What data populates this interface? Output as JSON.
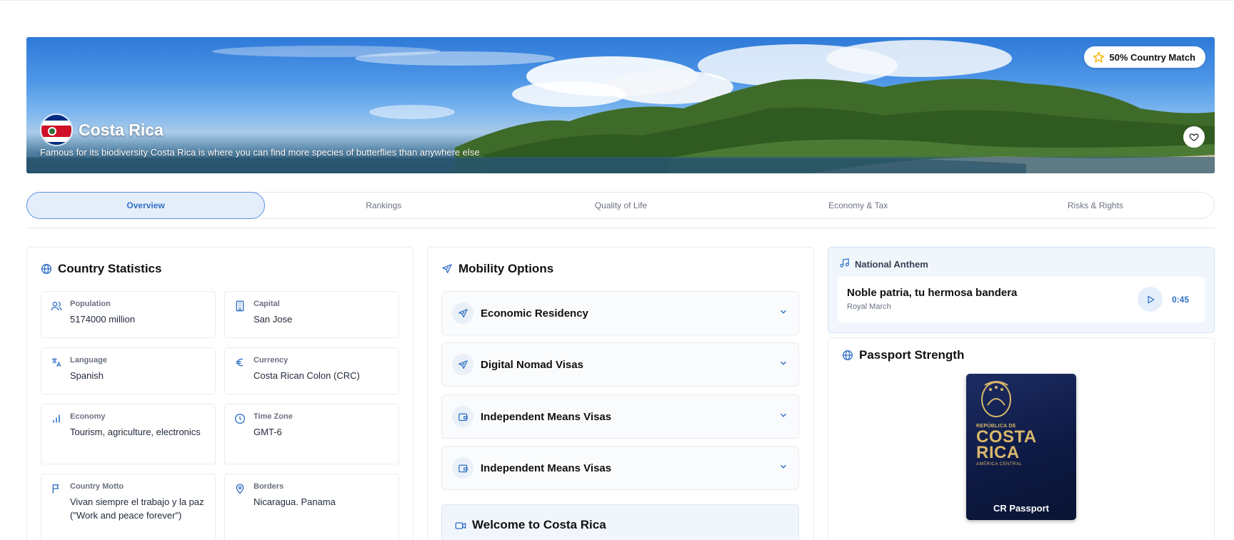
{
  "hero": {
    "country": "Costa Rica",
    "description": "Famous for its biodiversity Costa Rica is where you can find more species of butterflies than anywhere else",
    "match_badge": "50% Country Match",
    "flag_colors": [
      "#002b7f",
      "#ffffff",
      "#ce1126"
    ]
  },
  "tabs": [
    {
      "label": "Overview",
      "active": true
    },
    {
      "label": "Rankings"
    },
    {
      "label": "Quality of Life"
    },
    {
      "label": "Economy & Tax"
    },
    {
      "label": "Risks & Rights"
    }
  ],
  "stats": {
    "title": "Country Statistics",
    "items": [
      {
        "label": "Population",
        "value": "5174000 million",
        "icon": "users-icon"
      },
      {
        "label": "Capital",
        "value": "San Jose",
        "icon": "building-icon"
      },
      {
        "label": "Language",
        "value": "Spanish",
        "icon": "language-icon"
      },
      {
        "label": "Currency",
        "value": "Costa Rican Colon (CRC)",
        "icon": "euro-icon"
      },
      {
        "label": "Economy",
        "value": "Tourism, agriculture, electronics",
        "icon": "bar-chart-icon"
      },
      {
        "label": "Time Zone",
        "value": "GMT-6",
        "icon": "clock-icon"
      },
      {
        "label": "Country Motto",
        "value": "Vivan siempre el trabajo y la paz (\"Work and peace forever\")",
        "icon": "flag-icon"
      },
      {
        "label": "Borders",
        "value": "Nicaragua. Panama",
        "icon": "map-pin-icon"
      }
    ]
  },
  "mobility": {
    "title": "Mobility Options",
    "items": [
      {
        "label": "Economic Residency",
        "icon": "plane-icon"
      },
      {
        "label": "Digital Nomad Visas",
        "icon": "plane-icon"
      },
      {
        "label": "Independent Means Visas",
        "icon": "wallet-icon"
      },
      {
        "label": "Independent Means Visas",
        "icon": "wallet-icon"
      }
    ],
    "welcome_title": "Welcome to Costa Rica"
  },
  "anthem": {
    "heading": "National Anthem",
    "song_title": "Noble patria, tu hermosa bandera",
    "song_subtitle": "Royal March",
    "duration": "0:45"
  },
  "passport": {
    "title": "Passport Strength",
    "cover_small": "REPÚBLICA DE",
    "cover_line1": "COSTA",
    "cover_line2": "RICA",
    "cover_sub": "AMÉRICA CENTRAL",
    "label": "CR Passport"
  },
  "colors": {
    "accent": "#2f6fc6",
    "accent_bg": "#e4eefb",
    "star": "#f5b400"
  }
}
